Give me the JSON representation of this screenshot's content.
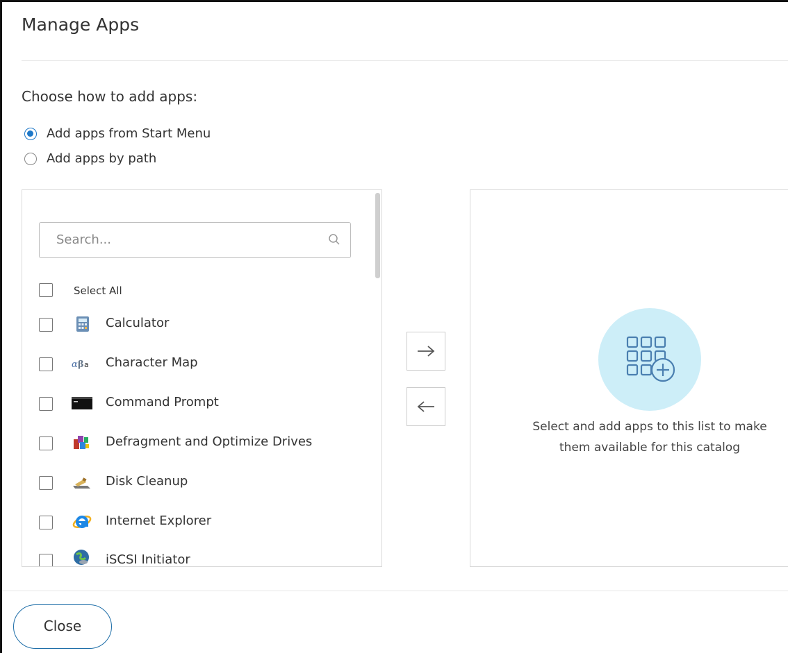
{
  "dialog": {
    "title": "Manage Apps"
  },
  "choose": {
    "label": "Choose how to add apps:",
    "options": [
      {
        "label": "Add apps from Start Menu",
        "selected": true
      },
      {
        "label": "Add apps by path",
        "selected": false
      }
    ]
  },
  "search": {
    "placeholder": "Search..."
  },
  "select_all": {
    "label": "Select All"
  },
  "apps": [
    {
      "label": "Calculator",
      "icon": "calculator-icon"
    },
    {
      "label": "Character Map",
      "icon": "character-map-icon"
    },
    {
      "label": "Command Prompt",
      "icon": "command-prompt-icon"
    },
    {
      "label": "Defragment and Optimize Drives",
      "icon": "defragment-icon"
    },
    {
      "label": "Disk Cleanup",
      "icon": "disk-cleanup-icon"
    },
    {
      "label": "Internet Explorer",
      "icon": "internet-explorer-icon"
    },
    {
      "label": "iSCSI Initiator",
      "icon": "iscsi-initiator-icon"
    }
  ],
  "empty_state": {
    "line1": "Select and add apps to this list to make",
    "line2": "them available for this catalog"
  },
  "footer": {
    "close_label": "Close"
  },
  "colors": {
    "accent": "#1e78c8",
    "empty_circle": "#cdeef8",
    "close_border": "#1e6ea8"
  }
}
